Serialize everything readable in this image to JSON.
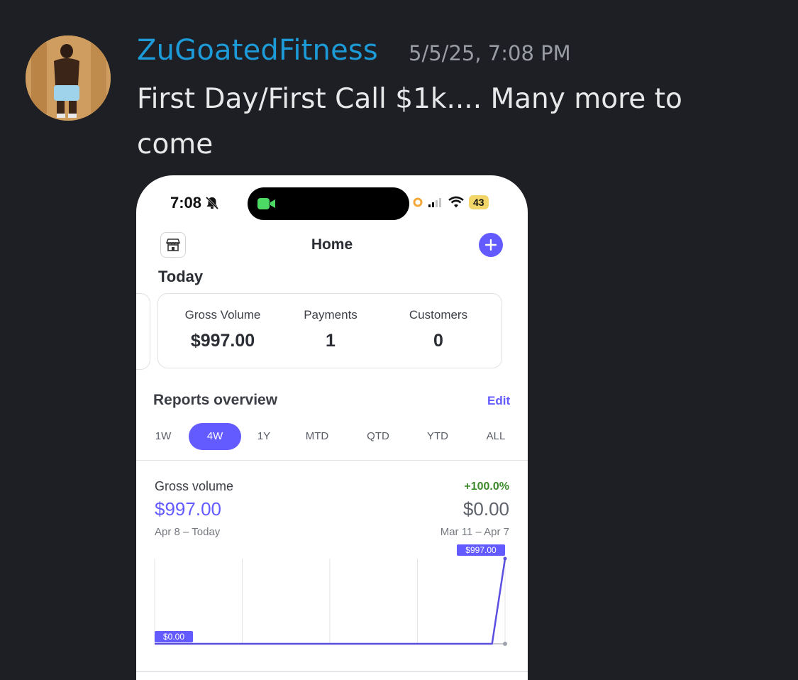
{
  "post": {
    "username": "ZuGoatedFitness",
    "timestamp": "5/5/25, 7:08 PM",
    "message": "First Day/First Call $1k.... Many more to come"
  },
  "phone": {
    "status": {
      "time": "7:08",
      "battery": "43",
      "icons": [
        "bell-muted-icon",
        "video-camera-icon",
        "recording-dot-icon",
        "cellular-signal-icon",
        "wifi-icon",
        "battery-icon"
      ]
    },
    "header": {
      "title": "Home",
      "left_icon": "store-icon",
      "right_icon": "plus-icon"
    },
    "today": {
      "title": "Today",
      "stats": [
        {
          "label": "Gross Volume",
          "value": "$997.00"
        },
        {
          "label": "Payments",
          "value": "1"
        },
        {
          "label": "Customers",
          "value": "0"
        }
      ]
    },
    "reports": {
      "title": "Reports overview",
      "edit_label": "Edit",
      "ranges": [
        "1W",
        "4W",
        "1Y",
        "MTD",
        "QTD",
        "YTD",
        "ALL"
      ],
      "active_range": "4W"
    },
    "gross_volume": {
      "label": "Gross volume",
      "change": "+100.0%",
      "value": "$997.00",
      "previous_value": "$0.00",
      "range": "Apr 8 – Today",
      "previous_range": "Mar 11 – Apr 7"
    }
  },
  "colors": {
    "background": "#1e1f24",
    "username": "#1d9bd8",
    "accent": "#635bff",
    "positive": "#3d8a2c"
  },
  "chart_data": {
    "type": "line",
    "series": [
      {
        "values": [
          0,
          0,
          0,
          0,
          0,
          0,
          0,
          0,
          0,
          0,
          0,
          0,
          0,
          0,
          0,
          0,
          0,
          0,
          0,
          0,
          0,
          0,
          0,
          0,
          0,
          0,
          0,
          997
        ]
      }
    ],
    "start_label": "$0.00",
    "end_label": "$997.00",
    "ylim": [
      0,
      997
    ],
    "grid": true
  }
}
